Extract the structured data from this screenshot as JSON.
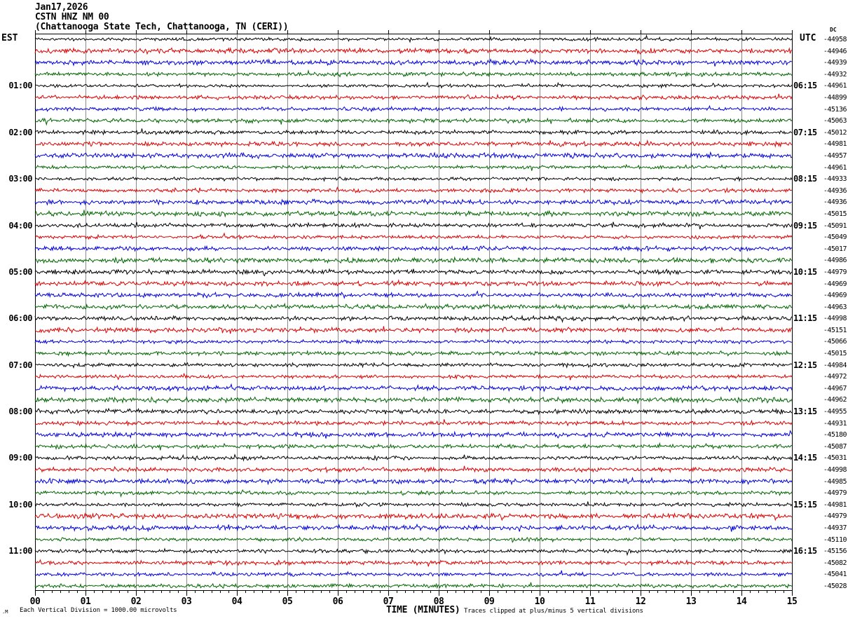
{
  "header": {
    "date": "Jan17,2026",
    "station_line": "CSTN HNZ NM 00",
    "location_line": "(Chattanooga State Tech, Chattanooga, TN (CERI))"
  },
  "axes": {
    "left_timezone_label": "EST",
    "right_timezone_label": "UTC",
    "dc_column_label": "DC",
    "x_axis_title": "TIME (MINUTES)"
  },
  "footer": {
    "left_note": "Each Vertical Division = 1000.00 microvolts",
    "right_note": "Traces clipped at plus/minus 5 vertical divisions",
    "corner_mark": ".M"
  },
  "chart_data": {
    "type": "line",
    "subtype": "helicorder-seismogram",
    "station": "CSTN HNZ NM 00",
    "station_name": "Chattanooga State Tech, Chattanooga, TN (CERI)",
    "date": "Jan17,2026",
    "minutes_per_line": 15,
    "x_range_minutes": [
      0,
      15
    ],
    "x_tick_labels": [
      "00",
      "01",
      "02",
      "03",
      "04",
      "05",
      "06",
      "07",
      "08",
      "09",
      "10",
      "11",
      "12",
      "13",
      "14",
      "15"
    ],
    "minor_ticks_per_minute": 6,
    "grid": true,
    "grid_color": "#8a8a8a",
    "trace_color_cycle": [
      "#000000",
      "#dd0000",
      "#0000dd",
      "#006600"
    ],
    "vertical_division_microvolts": 1000.0,
    "clip_divisions": 5,
    "waveform": "continuous low-amplitude background noise on every line; no visible seismic events; traces clipped at plus/minus 5 vertical divisions",
    "rows": [
      {
        "est_label": "",
        "utc_label": "",
        "dc": -44958,
        "color": "black"
      },
      {
        "est_label": "",
        "utc_label": "",
        "dc": -44946,
        "color": "red"
      },
      {
        "est_label": "",
        "utc_label": "",
        "dc": -44939,
        "color": "blue"
      },
      {
        "est_label": "",
        "utc_label": "",
        "dc": -44932,
        "color": "green"
      },
      {
        "est_label": "01:00",
        "utc_label": "06:15",
        "dc": -44961,
        "color": "black"
      },
      {
        "est_label": "",
        "utc_label": "",
        "dc": -44899,
        "color": "red"
      },
      {
        "est_label": "",
        "utc_label": "",
        "dc": -45136,
        "color": "blue"
      },
      {
        "est_label": "",
        "utc_label": "",
        "dc": -45063,
        "color": "green"
      },
      {
        "est_label": "02:00",
        "utc_label": "07:15",
        "dc": -45012,
        "color": "black"
      },
      {
        "est_label": "",
        "utc_label": "",
        "dc": -44981,
        "color": "red"
      },
      {
        "est_label": "",
        "utc_label": "",
        "dc": -44957,
        "color": "blue"
      },
      {
        "est_label": "",
        "utc_label": "",
        "dc": -44961,
        "color": "green"
      },
      {
        "est_label": "03:00",
        "utc_label": "08:15",
        "dc": -44933,
        "color": "black"
      },
      {
        "est_label": "",
        "utc_label": "",
        "dc": -44936,
        "color": "red"
      },
      {
        "est_label": "",
        "utc_label": "",
        "dc": -44936,
        "color": "blue"
      },
      {
        "est_label": "",
        "utc_label": "",
        "dc": -45015,
        "color": "green"
      },
      {
        "est_label": "04:00",
        "utc_label": "09:15",
        "dc": -45091,
        "color": "black"
      },
      {
        "est_label": "",
        "utc_label": "",
        "dc": -45049,
        "color": "red"
      },
      {
        "est_label": "",
        "utc_label": "",
        "dc": -45017,
        "color": "blue"
      },
      {
        "est_label": "",
        "utc_label": "",
        "dc": -44986,
        "color": "green"
      },
      {
        "est_label": "05:00",
        "utc_label": "10:15",
        "dc": -44979,
        "color": "black"
      },
      {
        "est_label": "",
        "utc_label": "",
        "dc": -44969,
        "color": "red"
      },
      {
        "est_label": "",
        "utc_label": "",
        "dc": -44969,
        "color": "blue"
      },
      {
        "est_label": "",
        "utc_label": "",
        "dc": -44963,
        "color": "green"
      },
      {
        "est_label": "06:00",
        "utc_label": "11:15",
        "dc": -44998,
        "color": "black"
      },
      {
        "est_label": "",
        "utc_label": "",
        "dc": -45151,
        "color": "red"
      },
      {
        "est_label": "",
        "utc_label": "",
        "dc": -45066,
        "color": "blue"
      },
      {
        "est_label": "",
        "utc_label": "",
        "dc": -45015,
        "color": "green"
      },
      {
        "est_label": "07:00",
        "utc_label": "12:15",
        "dc": -44984,
        "color": "black"
      },
      {
        "est_label": "",
        "utc_label": "",
        "dc": -44972,
        "color": "red"
      },
      {
        "est_label": "",
        "utc_label": "",
        "dc": -44967,
        "color": "blue"
      },
      {
        "est_label": "",
        "utc_label": "",
        "dc": -44962,
        "color": "green"
      },
      {
        "est_label": "08:00",
        "utc_label": "13:15",
        "dc": -44955,
        "color": "black"
      },
      {
        "est_label": "",
        "utc_label": "",
        "dc": -44931,
        "color": "red"
      },
      {
        "est_label": "",
        "utc_label": "",
        "dc": -45180,
        "color": "blue"
      },
      {
        "est_label": "",
        "utc_label": "",
        "dc": -45087,
        "color": "green"
      },
      {
        "est_label": "09:00",
        "utc_label": "14:15",
        "dc": -45031,
        "color": "black"
      },
      {
        "est_label": "",
        "utc_label": "",
        "dc": -44998,
        "color": "red"
      },
      {
        "est_label": "",
        "utc_label": "",
        "dc": -44985,
        "color": "blue"
      },
      {
        "est_label": "",
        "utc_label": "",
        "dc": -44979,
        "color": "green"
      },
      {
        "est_label": "10:00",
        "utc_label": "15:15",
        "dc": -44981,
        "color": "black"
      },
      {
        "est_label": "",
        "utc_label": "",
        "dc": -44979,
        "color": "red"
      },
      {
        "est_label": "",
        "utc_label": "",
        "dc": -44937,
        "color": "blue"
      },
      {
        "est_label": "",
        "utc_label": "",
        "dc": -45110,
        "color": "green"
      },
      {
        "est_label": "11:00",
        "utc_label": "16:15",
        "dc": -45156,
        "color": "black"
      },
      {
        "est_label": "",
        "utc_label": "",
        "dc": -45082,
        "color": "red"
      },
      {
        "est_label": "",
        "utc_label": "",
        "dc": -45041,
        "color": "blue"
      },
      {
        "est_label": "",
        "utc_label": "",
        "dc": -45028,
        "color": "green"
      }
    ]
  }
}
